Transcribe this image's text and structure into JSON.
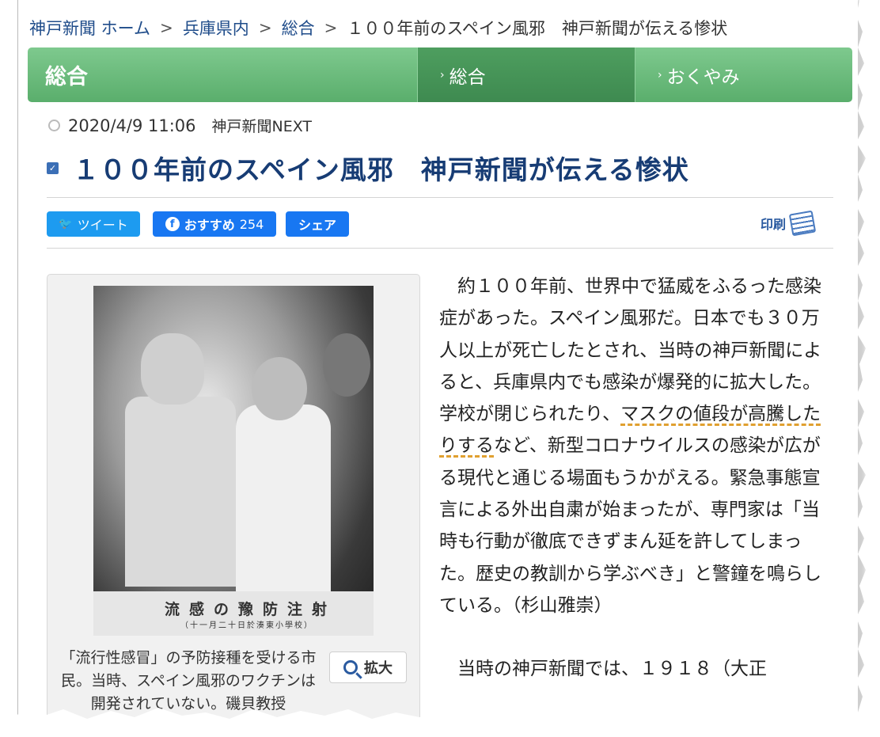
{
  "breadcrumb": {
    "home": "神戸新聞 ホーム",
    "region": "兵庫県内",
    "section": "総合",
    "current": "１００年前のスペイン風邪　神戸新聞が伝える惨状",
    "separator": ">"
  },
  "category_bar": {
    "title": "総合",
    "tabs": [
      {
        "label": "総合",
        "active": true
      },
      {
        "label": "おくやみ",
        "active": false
      }
    ],
    "chevron": "›"
  },
  "meta": {
    "datetime": "2020/4/9 11:06",
    "source": "神戸新聞NEXT"
  },
  "headline": "１００年前のスペイン風邪　神戸新聞が伝える惨状",
  "share": {
    "tweet_label": "ツイート",
    "recommend_label": "おすすめ",
    "recommend_count": "254",
    "share_label": "シェア",
    "print_label": "印刷"
  },
  "photo": {
    "embedded_caption": "流感の豫防注射",
    "embedded_subcaption": "（十一月二十日於湊東小學校）",
    "caption": "「流行性感冒」の予防接種を受ける市民。当時、スペイン風邪のワクチンは開発されていない。磯貝教授",
    "zoom_label": "拡大"
  },
  "article": {
    "p1_before": "約１００年前、世界中で猛威をふるった感染症があった。スペイン風邪だ。日本でも３０万人以上が死亡したとされ、当時の神戸新聞によると、兵庫県内でも感染が爆発的に拡大した。学校が閉じられたり、",
    "p1_highlight": "マスクの値段が高騰したりする",
    "p1_after": "など、新型コロナウイルスの感染が広がる現代と通じる場面もうかがえる。緊急事態宣言による外出自粛が始まったが、専門家は「当時も行動が徹底できずまん延を許してしまった。歴史の教訓から学ぶべき」と警鐘を鳴らしている。（杉山雅崇）",
    "p2": "当時の神戸新聞では、１９１８（大正"
  },
  "colors": {
    "link": "#1f4c8a",
    "headline": "#173c74",
    "category_green": "#5aae6c",
    "highlight_underline": "#e0a030"
  }
}
